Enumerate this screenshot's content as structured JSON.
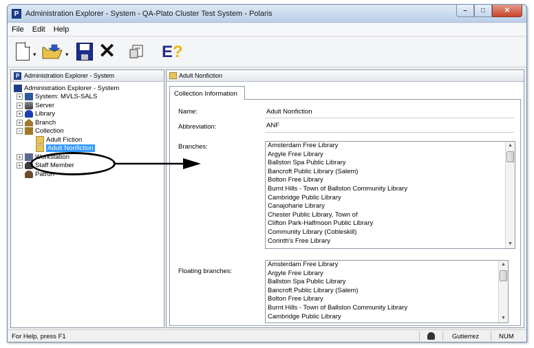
{
  "window": {
    "title": "Administration Explorer - System - QA-Plato     Cluster Test System - Polaris",
    "app_icon_letter": "P",
    "min_glyph": "–",
    "max_glyph": "□",
    "close_glyph": "✕"
  },
  "menu": [
    "File",
    "Edit",
    "Help"
  ],
  "toolbar": {
    "drop_glyph": "▾",
    "delete_glyph": "✕",
    "help_glyph": "E",
    "help_glyph_mark": "?"
  },
  "left_pane": {
    "header": "Administration Explorer - System",
    "header_icon_letter": "P",
    "tree": [
      {
        "label": "Administration Explorer - System",
        "icon": "admin-icon"
      },
      {
        "label": "System: MVLS-SALS",
        "expander": "+",
        "icon": "system-icon"
      },
      {
        "label": "Server",
        "expander": "+",
        "icon": "server-icon"
      },
      {
        "label": "Library",
        "expander": "+",
        "icon": "library-icon"
      },
      {
        "label": "Branch",
        "expander": "+",
        "icon": "branch-icon"
      },
      {
        "label": "Collection",
        "expander": "−",
        "icon": "collection-icon"
      },
      {
        "label": "Adult Fiction",
        "icon": "folder-icon"
      },
      {
        "label": "Adult Nonfiction",
        "icon": "folder-icon",
        "selected": true
      },
      {
        "label": "Workstation",
        "expander": "+",
        "icon": "workstation-icon"
      },
      {
        "label": "Staff Member",
        "expander": "+",
        "icon": "staff-icon"
      },
      {
        "label": "Patron",
        "icon": "patron-icon"
      }
    ]
  },
  "right_pane": {
    "header": "Adult Nonfiction",
    "tab_label": "Collection Information",
    "fields": {
      "name_label": "Name:",
      "name_value": "Adult Nonfiction",
      "abbrev_label": "Abbreviation:",
      "abbrev_value": "ANF",
      "branches_label": "Branches:",
      "floating_label": "Floating branches:"
    },
    "branches": [
      "Amsterdam Free Library",
      "Argyle Free Library",
      "Ballston Spa Public Library",
      "Bancroft Public Library (Salem)",
      "Bolton Free Library",
      "Burnt Hills - Town of Ballston Community Library",
      "Cambridge Public Library",
      "Canajoharie Library",
      "Chester Public Library, Town of",
      "Clifton Park-Halfmoon Public Library",
      "Community Library (Cobleskill)",
      "Corinth's Free Library"
    ],
    "floating_branches": [
      "Amsterdam Free Library",
      "Argyle Free Library",
      "Ballston Spa Public Library",
      "Bancroft Public Library (Salem)",
      "Bolton Free Library",
      "Burnt Hills - Town of Ballston Community Library",
      "Cambridge Public Library"
    ]
  },
  "statusbar": {
    "message": "For Help, press F1",
    "user": "Gutierrez",
    "num": "NUM"
  },
  "colors": {
    "selection": "#3399ff",
    "title_gradient_top": "#dfe9f6",
    "title_gradient_bottom": "#b9cfe9"
  }
}
